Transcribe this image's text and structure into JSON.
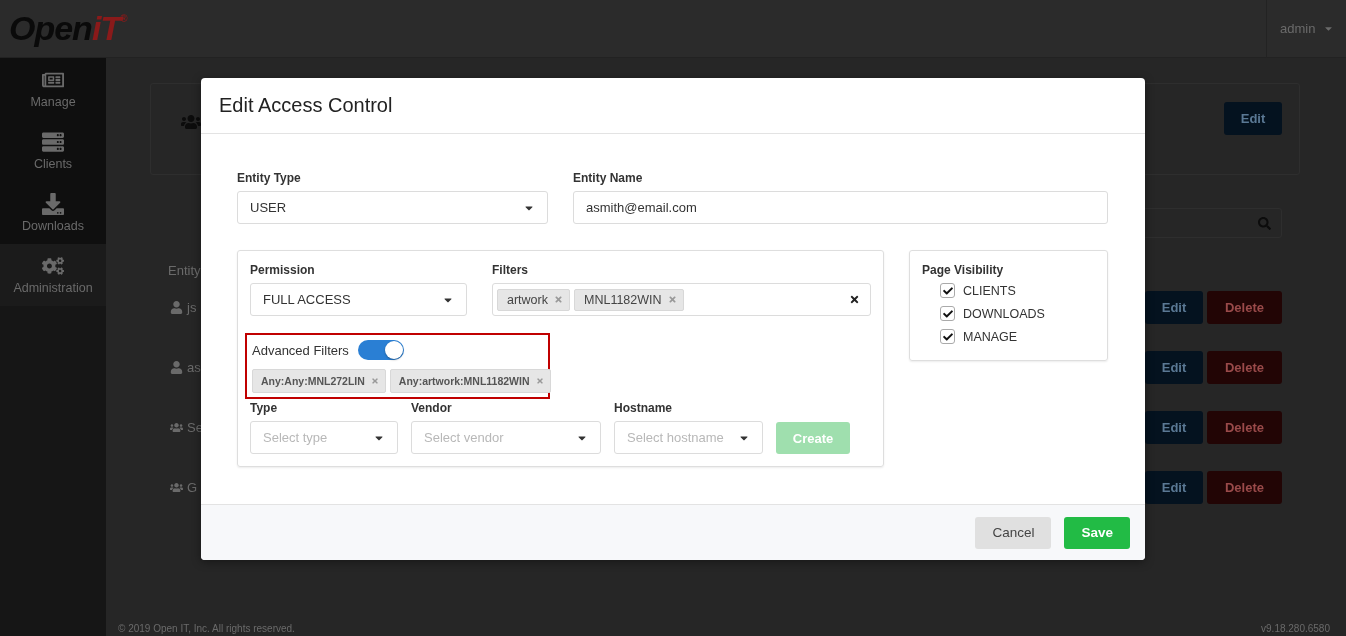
{
  "header": {
    "logo": {
      "text": "Open",
      "accent": "iT",
      "mark": "®"
    },
    "user": "admin"
  },
  "sidebar": {
    "items": [
      {
        "label": "Manage",
        "kind": "manage",
        "selected": false
      },
      {
        "label": "Clients",
        "kind": "clients",
        "selected": false
      },
      {
        "label": "Downloads",
        "kind": "downloads",
        "selected": false
      },
      {
        "label": "Administration",
        "kind": "administration",
        "selected": true
      }
    ]
  },
  "background": {
    "card_button": "Edit",
    "section_heading": "Entity",
    "rows": [
      {
        "name": "js",
        "kind": "user",
        "edit": "Edit",
        "delete": "Delete"
      },
      {
        "name": "as",
        "kind": "user",
        "edit": "Edit",
        "delete": "Delete"
      },
      {
        "name": "Se",
        "kind": "group",
        "edit": "Edit",
        "delete": "Delete"
      },
      {
        "name": "G",
        "kind": "group",
        "edit": "Edit",
        "delete": "Delete"
      }
    ],
    "footer": {
      "copyright": "© 2019 Open IT, Inc. All rights reserved.",
      "version": "v9.18.280.6580"
    }
  },
  "modal": {
    "title": "Edit Access Control",
    "entity_type": {
      "label": "Entity Type",
      "value": "USER"
    },
    "entity_name": {
      "label": "Entity Name",
      "value": "asmith@email.com"
    },
    "permission": {
      "label": "Permission",
      "value": "FULL ACCESS"
    },
    "filters": {
      "label": "Filters",
      "tags": [
        "artwork",
        "MNL1182WIN"
      ]
    },
    "advanced_filters": {
      "label": "Advanced Filters",
      "on": true,
      "highlighted": true,
      "tags": [
        "Any:Any:MNL272LIN",
        "Any:artwork:MNL1182WIN"
      ]
    },
    "type": {
      "label": "Type",
      "placeholder": "Select type"
    },
    "vendor": {
      "label": "Vendor",
      "placeholder": "Select vendor"
    },
    "hostname": {
      "label": "Hostname",
      "placeholder": "Select hostname"
    },
    "create_button": {
      "label": "Create",
      "disabled": true
    },
    "page_visibility": {
      "title": "Page Visibility",
      "items": [
        {
          "label": "CLIENTS",
          "checked": true
        },
        {
          "label": "DOWNLOADS",
          "checked": true
        },
        {
          "label": "MANAGE",
          "checked": true
        }
      ]
    },
    "buttons": {
      "cancel": "Cancel",
      "save": "Save"
    }
  }
}
